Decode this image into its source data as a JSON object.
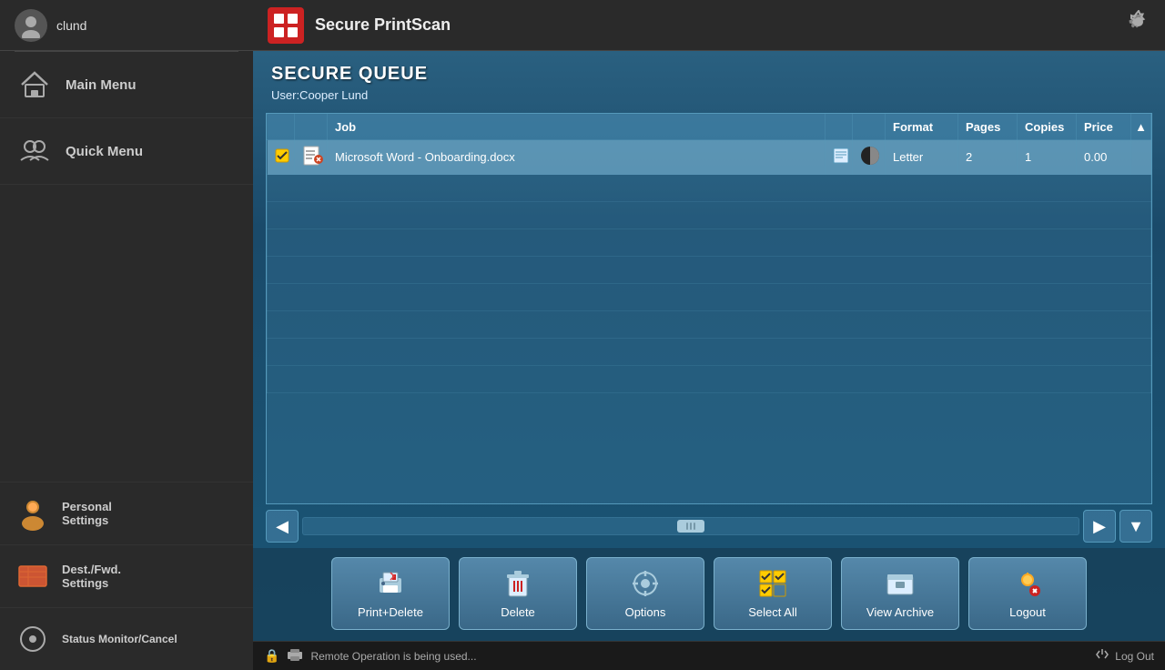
{
  "user": {
    "name": "clund"
  },
  "app": {
    "title": "Secure PrintScan"
  },
  "sidebar": {
    "nav_items": [
      {
        "id": "main-menu",
        "label": "Main Menu",
        "icon": "🏠"
      },
      {
        "id": "quick-menu",
        "label": "Quick Menu",
        "icon": "👥"
      }
    ],
    "bottom_items": [
      {
        "id": "personal-settings",
        "label1": "Personal",
        "label2": "Settings"
      },
      {
        "id": "dest-fwd-settings",
        "label1": "Dest./Fwd.",
        "label2": "Settings"
      },
      {
        "id": "status-monitor",
        "label": "Status Monitor/Cancel"
      }
    ]
  },
  "queue": {
    "title": "SECURE QUEUE",
    "user_label": "User:Cooper Lund"
  },
  "table": {
    "headers": [
      "",
      "",
      "Job",
      "",
      "",
      "Format",
      "Pages",
      "Copies",
      "Price"
    ],
    "rows": [
      {
        "selected": true,
        "job": "Microsoft Word - Onboarding.docx",
        "format": "Letter",
        "pages": "2",
        "copies": "1",
        "price": "0.00"
      }
    ]
  },
  "buttons": [
    {
      "id": "print-delete",
      "label": "Print+Delete",
      "icon": "🖨"
    },
    {
      "id": "delete",
      "label": "Delete",
      "icon": "🗑"
    },
    {
      "id": "options",
      "label": "Options",
      "icon": "⚙"
    },
    {
      "id": "select-all",
      "label": "Select All",
      "icon": "☑"
    },
    {
      "id": "view-archive",
      "label": "View Archive",
      "icon": "📦"
    },
    {
      "id": "logout",
      "label": "Logout",
      "icon": "🔓"
    }
  ],
  "statusbar": {
    "remote_op_msg": "Remote Operation is being used...",
    "logout_label": "Log Out"
  }
}
